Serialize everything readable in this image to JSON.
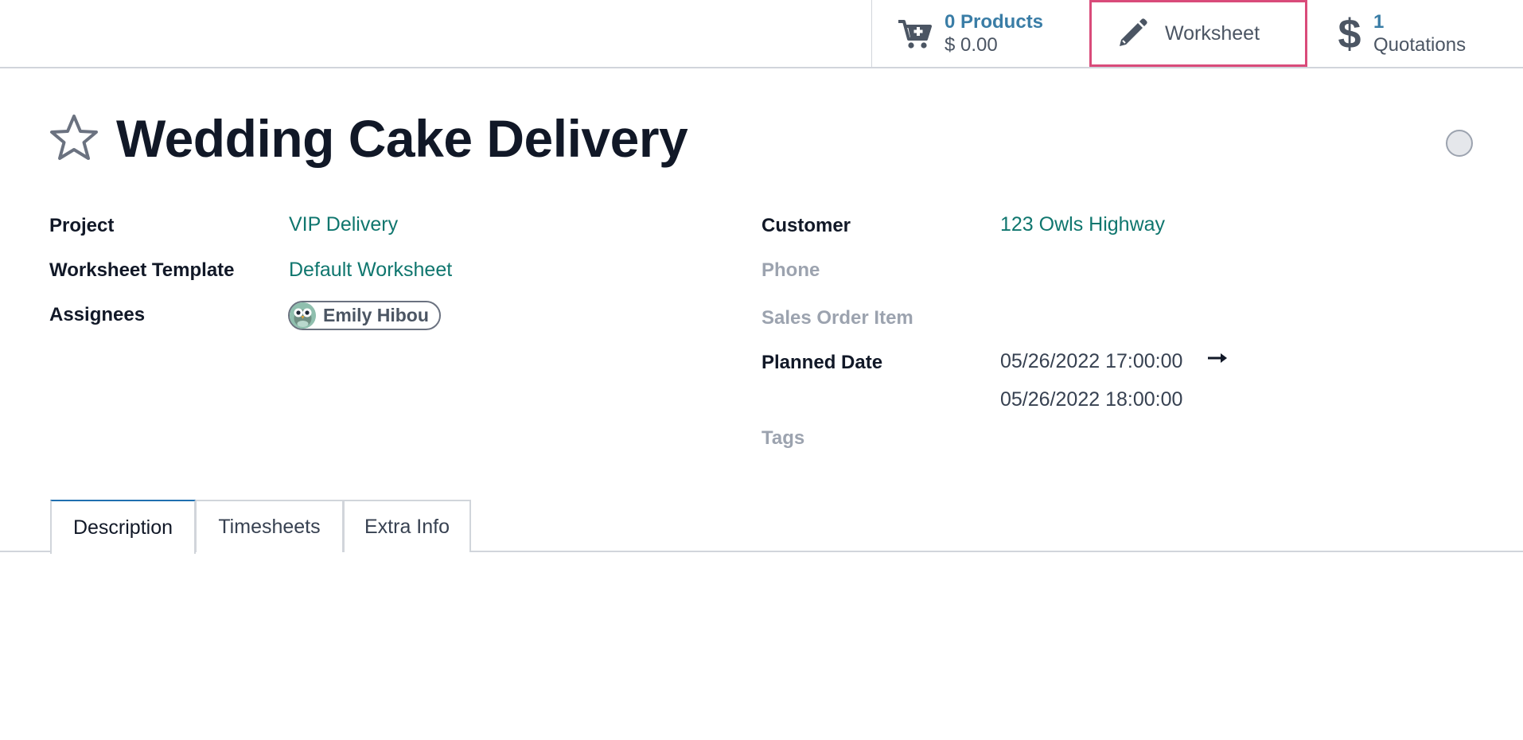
{
  "smart_buttons": {
    "products": {
      "count_label": "0 Products",
      "amount": "$ 0.00",
      "icon": "cart-plus-icon"
    },
    "worksheet": {
      "label": "Worksheet",
      "icon": "pencil-icon",
      "highlight_color": "#d94b7a"
    },
    "quotations": {
      "count": "1",
      "label": "Quotations",
      "icon": "dollar-icon"
    }
  },
  "record": {
    "title": "Wedding Cake Delivery",
    "favorite": false
  },
  "left_fields": {
    "project": {
      "label": "Project",
      "value": "VIP Delivery"
    },
    "worksheet_template": {
      "label": "Worksheet Template",
      "value": "Default Worksheet"
    },
    "assignees": {
      "label": "Assignees",
      "value": "Emily Hibou"
    }
  },
  "right_fields": {
    "customer": {
      "label": "Customer",
      "value": "123 Owls Highway"
    },
    "phone": {
      "label": "Phone",
      "value": ""
    },
    "sales_order_item": {
      "label": "Sales Order Item",
      "value": ""
    },
    "planned_date": {
      "label": "Planned Date",
      "start": "05/26/2022 17:00:00",
      "end": "05/26/2022 18:00:00"
    },
    "tags": {
      "label": "Tags",
      "value": ""
    }
  },
  "tabs": [
    {
      "label": "Description",
      "active": true
    },
    {
      "label": "Timesheets",
      "active": false
    },
    {
      "label": "Extra Info",
      "active": false
    }
  ],
  "colors": {
    "link": "#0f766e",
    "accent_blue": "#3a7da6",
    "active_tab": "#1f6fb0"
  }
}
